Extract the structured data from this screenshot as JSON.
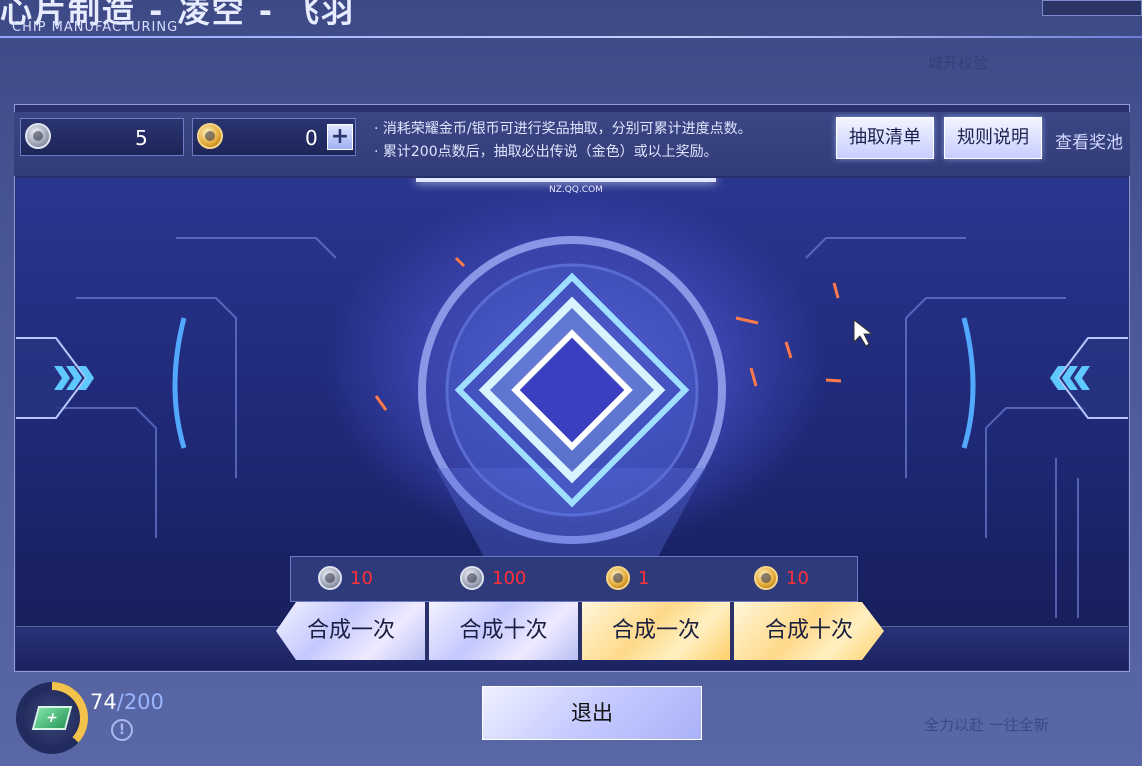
{
  "header": {
    "title": "心片制造 - 凌空 - 飞羽",
    "subtitle": "CHIP MANUFACTURING"
  },
  "currencies": [
    {
      "type": "silver",
      "icon": "silver-coin-icon",
      "value": "5"
    },
    {
      "type": "gold",
      "icon": "gold-coin-icon",
      "value": "0",
      "add_label": "+"
    }
  ],
  "info": {
    "line1": "· 消耗荣耀金币/银币可进行奖品抽取，分别可累计进度点数。",
    "line2": "· 累计200点数后，抽取必出传说（金色）或以上奖励。"
  },
  "buttons": {
    "draw_list": "抽取清单",
    "rules": "规则说明",
    "view_pool": "查看奖池",
    "exit": "退出"
  },
  "stage": {
    "watermark": "NZ.QQ.COM"
  },
  "synth_options": [
    {
      "coin": "silver",
      "cost": "10",
      "label": "合成一次"
    },
    {
      "coin": "silver",
      "cost": "100",
      "label": "合成十次"
    },
    {
      "coin": "gold",
      "cost": "1",
      "label": "合成一次"
    },
    {
      "coin": "gold",
      "cost": "10",
      "label": "合成十次"
    }
  ],
  "progress": {
    "current": "74",
    "separator": "/",
    "max": "200",
    "fraction": 0.37,
    "info_icon": "!"
  },
  "background_text": {
    "top_right": "城开校验",
    "bottom_right": "全力以赴 一往全新"
  },
  "colors": {
    "accent_gold": "#f3c24a",
    "cost_red": "#ff2f3a",
    "panel_bg": "#27306a"
  }
}
